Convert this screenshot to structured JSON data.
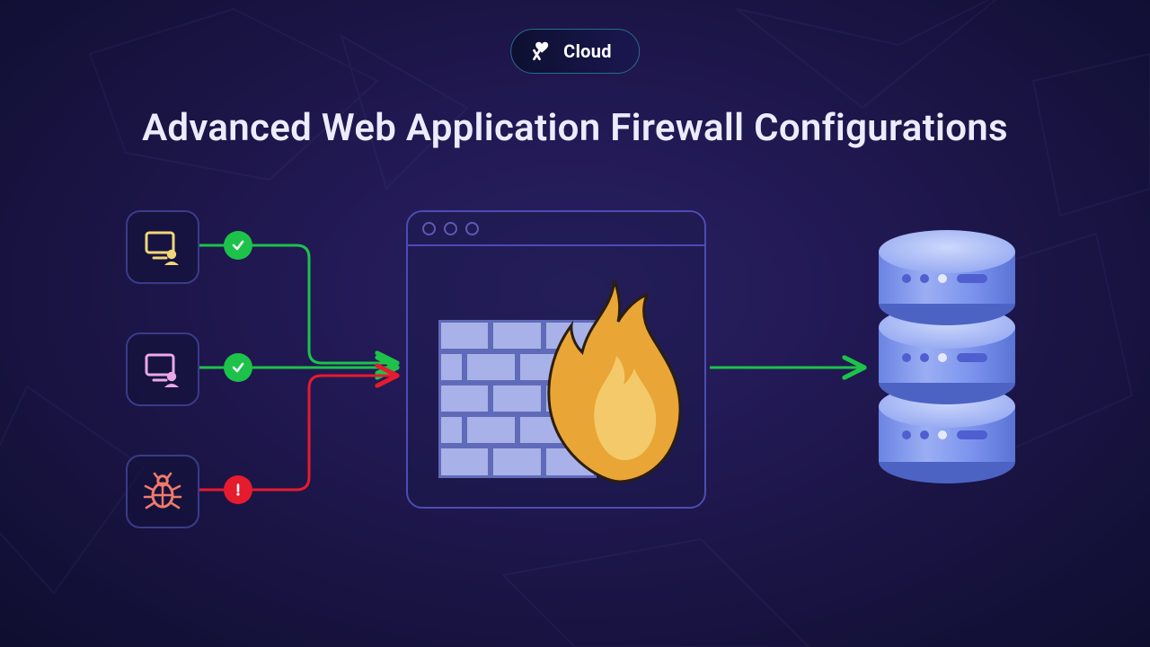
{
  "brand": {
    "name": "Cloud"
  },
  "title": "Advanced Web Application Firewall Configurations",
  "clients": [
    {
      "type": "user",
      "status": "allowed",
      "status_icon": "check",
      "icon_color": "#f1d67a",
      "flow_color": "#1dc24a"
    },
    {
      "type": "user",
      "status": "allowed",
      "status_icon": "check",
      "icon_color": "#e9a9e9",
      "flow_color": "#1dc24a"
    },
    {
      "type": "threat",
      "status": "blocked",
      "status_icon": "alert",
      "icon_color": "#f07a6a",
      "flow_color": "#e51b2e"
    }
  ],
  "waf": {
    "label": "Web Application Firewall"
  },
  "destination": {
    "label": "Database server"
  },
  "colors": {
    "bg_start": "#2a2060",
    "bg_end": "#10102f",
    "allow": "#1dc24a",
    "block": "#e51b2e",
    "border": "#4c4cb3",
    "brick": "#a9b2e8",
    "mortar": "#5f6ab8",
    "flame_outer": "#e9a535",
    "flame_inner": "#f3c96a",
    "db_light": "#a7baf6",
    "db_mid": "#7f97ef",
    "db_dark": "#5a73d4"
  }
}
